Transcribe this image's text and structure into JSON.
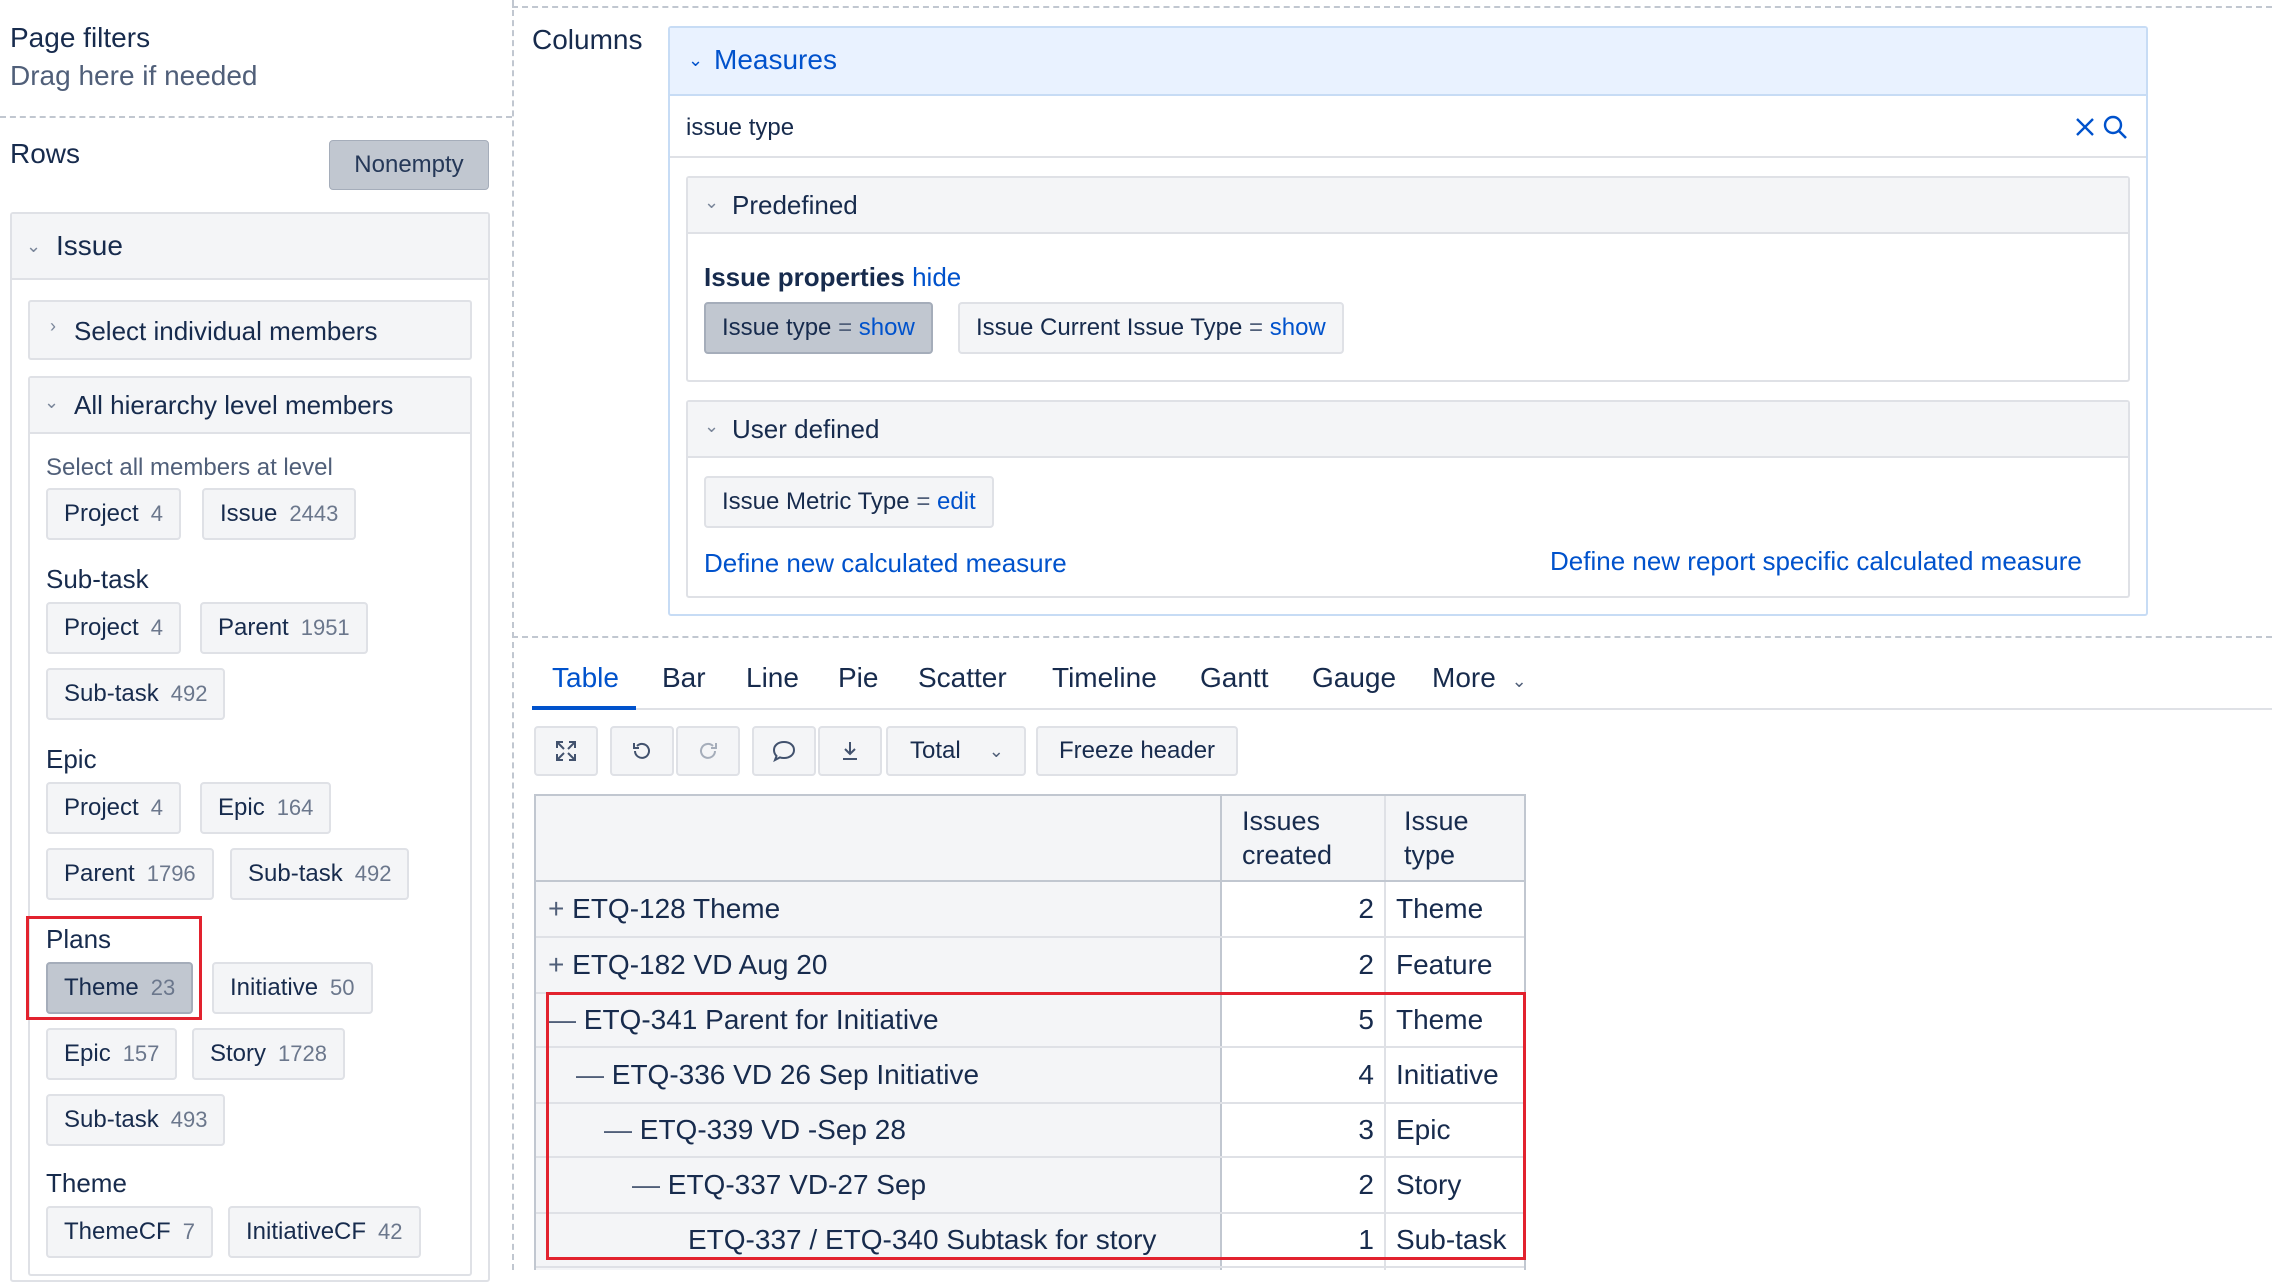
{
  "page_filters": {
    "title": "Page filters",
    "hint": "Drag here if needed"
  },
  "rows": {
    "title": "Rows",
    "nonempty_label": "Nonempty"
  },
  "issue_panel": {
    "title": "Issue",
    "select_individual": "Select individual members",
    "all_hierarchy": "All hierarchy level members",
    "select_all_text": "Select all members at level",
    "groups": [
      {
        "name": "",
        "chips": [
          {
            "label": "Project",
            "count": "4"
          },
          {
            "label": "Issue",
            "count": "2443"
          }
        ]
      },
      {
        "name": "Sub-task",
        "chips": [
          {
            "label": "Project",
            "count": "4"
          },
          {
            "label": "Parent",
            "count": "1951"
          },
          {
            "label": "Sub-task",
            "count": "492"
          }
        ]
      },
      {
        "name": "Epic",
        "chips": [
          {
            "label": "Project",
            "count": "4"
          },
          {
            "label": "Epic",
            "count": "164"
          },
          {
            "label": "Parent",
            "count": "1796"
          },
          {
            "label": "Sub-task",
            "count": "492"
          }
        ]
      },
      {
        "name": "Plans",
        "chips": [
          {
            "label": "Theme",
            "count": "23"
          },
          {
            "label": "Initiative",
            "count": "50"
          },
          {
            "label": "Epic",
            "count": "157"
          },
          {
            "label": "Story",
            "count": "1728"
          },
          {
            "label": "Sub-task",
            "count": "493"
          }
        ]
      },
      {
        "name": "Theme",
        "chips": [
          {
            "label": "ThemeCF",
            "count": "7"
          },
          {
            "label": "InitiativeCF",
            "count": "42"
          }
        ]
      }
    ]
  },
  "columns": {
    "title": "Columns"
  },
  "measures": {
    "title": "Measures",
    "search_value": "issue type",
    "predefined_title": "Predefined",
    "issue_properties_label": "Issue properties",
    "hide_label": "hide",
    "chip1_label": "Issue type",
    "chip2_label": "Issue Current Issue Type",
    "eq": "=",
    "show_label": "show",
    "user_defined_title": "User defined",
    "chip3_label": "Issue Metric Type",
    "edit_label": "edit",
    "define_new": "Define new calculated measure",
    "define_report": "Define new report specific calculated measure"
  },
  "view_tabs": [
    "Table",
    "Bar",
    "Line",
    "Pie",
    "Scatter",
    "Timeline",
    "Gantt",
    "Gauge",
    "More"
  ],
  "toolbar": {
    "total_label": "Total",
    "freeze_label": "Freeze header"
  },
  "table": {
    "headers": {
      "issues_created_1": "Issues",
      "issues_created_2": "created",
      "issue_type_1": "Issue",
      "issue_type_2": "type"
    },
    "rows": [
      {
        "prefix": "+",
        "name": "ETQ-128 Theme",
        "count": "2",
        "type": "Theme"
      },
      {
        "prefix": "+",
        "name": "ETQ-182 VD Aug 20",
        "count": "2",
        "type": "Feature"
      },
      {
        "prefix": "—",
        "name": "ETQ-341 Parent for Initiative",
        "count": "5",
        "type": "Theme"
      },
      {
        "prefix": "—",
        "name": "ETQ-336 VD 26 Sep Initiative",
        "count": "4",
        "type": "Initiative"
      },
      {
        "prefix": "—",
        "name": "ETQ-339 VD -Sep 28",
        "count": "3",
        "type": "Epic"
      },
      {
        "prefix": "—",
        "name": "ETQ-337 VD-27 Sep",
        "count": "2",
        "type": "Story"
      },
      {
        "prefix": "",
        "name": "ETQ-337 / ETQ-340 Subtask for story",
        "count": "1",
        "type": "Sub-task"
      }
    ]
  },
  "colors": {
    "accent": "#0052cc",
    "highlight": "#e2222e",
    "selected_chip": "#c1c7d0"
  }
}
